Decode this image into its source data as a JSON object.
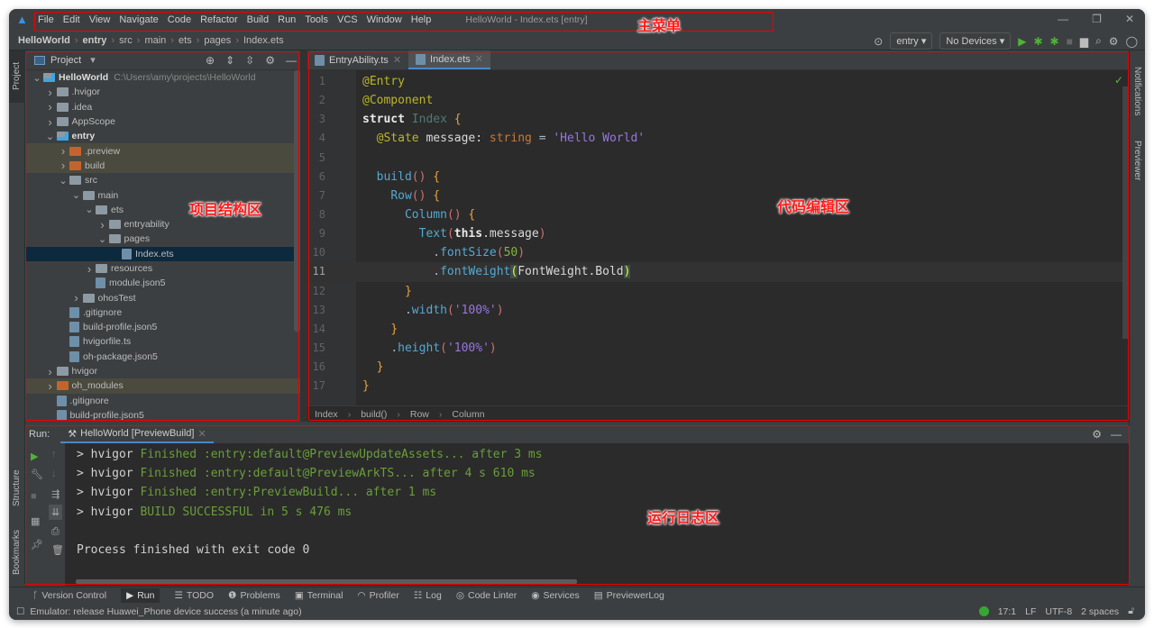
{
  "title": {
    "menu": [
      "File",
      "Edit",
      "View",
      "Navigate",
      "Code",
      "Refactor",
      "Build",
      "Run",
      "Tools",
      "VCS",
      "Window",
      "Help"
    ],
    "window_title": "HelloWorld - Index.ets [entry]"
  },
  "nav": {
    "breadcrumb": [
      "HelloWorld",
      "entry",
      "src",
      "main",
      "ets",
      "pages",
      "Index.ets"
    ],
    "run_config": "entry",
    "device": "No Devices"
  },
  "left_strip": {
    "project": "Project",
    "structure": "Structure",
    "bookmarks": "Bookmarks"
  },
  "right_strip": {
    "notifications": "Notifications",
    "previewer": "Previewer"
  },
  "project": {
    "title": "Project",
    "tree": [
      {
        "label": "HelloWorld",
        "level": 0,
        "kind": "module",
        "open": true,
        "bold": true,
        "hint": "C:\\Users\\amy\\projects\\HelloWorld"
      },
      {
        "label": ".hvigor",
        "level": 1,
        "kind": "folder",
        "open": false
      },
      {
        "label": ".idea",
        "level": 1,
        "kind": "folder",
        "open": false
      },
      {
        "label": "AppScope",
        "level": 1,
        "kind": "folder",
        "open": false
      },
      {
        "label": "entry",
        "level": 1,
        "kind": "module",
        "open": true,
        "bold": true
      },
      {
        "label": ".preview",
        "level": 2,
        "kind": "excluded",
        "open": false,
        "hl": true
      },
      {
        "label": "build",
        "level": 2,
        "kind": "excluded",
        "open": false,
        "hl": true
      },
      {
        "label": "src",
        "level": 2,
        "kind": "folder",
        "open": true
      },
      {
        "label": "main",
        "level": 3,
        "kind": "folder",
        "open": true
      },
      {
        "label": "ets",
        "level": 4,
        "kind": "folder",
        "open": true
      },
      {
        "label": "entryability",
        "level": 5,
        "kind": "folder",
        "open": false
      },
      {
        "label": "pages",
        "level": 5,
        "kind": "folder",
        "open": true
      },
      {
        "label": "Index.ets",
        "level": 6,
        "kind": "file",
        "sel": true
      },
      {
        "label": "resources",
        "level": 4,
        "kind": "folder",
        "open": false
      },
      {
        "label": "module.json5",
        "level": 4,
        "kind": "file"
      },
      {
        "label": "ohosTest",
        "level": 3,
        "kind": "folder",
        "open": false
      },
      {
        "label": ".gitignore",
        "level": 2,
        "kind": "file"
      },
      {
        "label": "build-profile.json5",
        "level": 2,
        "kind": "file"
      },
      {
        "label": "hvigorfile.ts",
        "level": 2,
        "kind": "file"
      },
      {
        "label": "oh-package.json5",
        "level": 2,
        "kind": "file"
      },
      {
        "label": "hvigor",
        "level": 1,
        "kind": "folder",
        "open": false
      },
      {
        "label": "oh_modules",
        "level": 1,
        "kind": "excluded",
        "open": false,
        "hl": true
      },
      {
        "label": ".gitignore",
        "level": 1,
        "kind": "file"
      },
      {
        "label": "build-profile.json5",
        "level": 1,
        "kind": "file"
      }
    ]
  },
  "editor": {
    "tabs": [
      {
        "label": "EntryAbility.ts",
        "active": false
      },
      {
        "label": "Index.ets",
        "active": true
      }
    ],
    "current_line": 11,
    "lines": [
      [
        [
          "@Entry",
          "an"
        ]
      ],
      [
        [
          "@Component",
          "an"
        ]
      ],
      [
        [
          "struct ",
          "kw"
        ],
        [
          "Index ",
          "cls"
        ],
        [
          "{",
          "br"
        ]
      ],
      [
        [
          "  ",
          " "
        ],
        [
          "@State ",
          "an"
        ],
        [
          "message: ",
          "id"
        ],
        [
          "string ",
          "ty"
        ],
        [
          "= ",
          "op"
        ],
        [
          "'Hello World'",
          "str"
        ]
      ],
      [],
      [
        [
          "  ",
          " "
        ],
        [
          "build",
          "fn"
        ],
        [
          "()",
          "pa"
        ],
        [
          " {",
          "br"
        ]
      ],
      [
        [
          "    ",
          " "
        ],
        [
          "Row",
          "fn"
        ],
        [
          "()",
          "pa"
        ],
        [
          " {",
          "br"
        ]
      ],
      [
        [
          "      ",
          " "
        ],
        [
          "Column",
          "fn"
        ],
        [
          "()",
          "pa"
        ],
        [
          " {",
          "br"
        ]
      ],
      [
        [
          "        ",
          " "
        ],
        [
          "Text",
          "fn"
        ],
        [
          "(",
          "pa"
        ],
        [
          "this",
          "kw"
        ],
        [
          ".message",
          "id"
        ],
        [
          ")",
          "pa"
        ]
      ],
      [
        [
          "          ",
          " "
        ],
        [
          ".",
          "op"
        ],
        [
          "fontSize",
          "fn"
        ],
        [
          "(",
          "pa"
        ],
        [
          "50",
          "num"
        ],
        [
          ")",
          "pa"
        ]
      ],
      [
        [
          "          ",
          " "
        ],
        [
          ".",
          "op"
        ],
        [
          "fontWeight",
          "fn"
        ],
        [
          "(",
          "mb"
        ],
        [
          "FontWeight.Bold",
          "id"
        ],
        [
          ")",
          "mb"
        ]
      ],
      [
        [
          "      ",
          " "
        ],
        [
          "}",
          "br"
        ]
      ],
      [
        [
          "      ",
          " "
        ],
        [
          ".",
          "op"
        ],
        [
          "width",
          "fn"
        ],
        [
          "(",
          "pa"
        ],
        [
          "'100%'",
          "str"
        ],
        [
          ")",
          "pa"
        ]
      ],
      [
        [
          "    ",
          " "
        ],
        [
          "}",
          "br"
        ]
      ],
      [
        [
          "    ",
          " "
        ],
        [
          ".",
          "op"
        ],
        [
          "height",
          "fn"
        ],
        [
          "(",
          "pa"
        ],
        [
          "'100%'",
          "str"
        ],
        [
          ")",
          "pa"
        ]
      ],
      [
        [
          "  ",
          " "
        ],
        [
          "}",
          "br"
        ]
      ],
      [
        [
          "}",
          "br"
        ]
      ]
    ],
    "breadcrumb": [
      "Index",
      "build()",
      "Row",
      "Column"
    ]
  },
  "run": {
    "label": "Run:",
    "tab": "HelloWorld [PreviewBuild]",
    "log": [
      {
        "p": "> hvigor ",
        "g": "Finished :entry:default@PreviewUpdateAssets... after 3 ms"
      },
      {
        "p": "> hvigor ",
        "g": "Finished :entry:default@PreviewArkTS... after 4 s 610 ms"
      },
      {
        "p": "> hvigor ",
        "g": "Finished :entry:PreviewBuild... after 1 ms"
      },
      {
        "p": "> hvigor ",
        "g": "BUILD SUCCESSFUL in 5 s 476 ms"
      },
      {
        "p": "",
        "g": ""
      },
      {
        "p": "Process finished with exit code 0",
        "g": ""
      }
    ]
  },
  "bottom_tabs": [
    {
      "icon": "branch",
      "label": "Version Control"
    },
    {
      "icon": "play",
      "label": "Run",
      "active": true
    },
    {
      "icon": "list",
      "label": "TODO"
    },
    {
      "icon": "alert",
      "label": "Problems"
    },
    {
      "icon": "terminal",
      "label": "Terminal"
    },
    {
      "icon": "gauge",
      "label": "Profiler"
    },
    {
      "icon": "log",
      "label": "Log"
    },
    {
      "icon": "linter",
      "label": "Code Linter"
    },
    {
      "icon": "services",
      "label": "Services"
    },
    {
      "icon": "doc",
      "label": "PreviewerLog"
    }
  ],
  "status": {
    "message": "Emulator: release Huawei_Phone device success (a minute ago)",
    "position": "17:1",
    "line_sep": "LF",
    "encoding": "UTF-8",
    "indent": "2 spaces",
    "status_color": "#36a832"
  },
  "annotations": {
    "menu": "主菜单",
    "project": "项目结构区",
    "editor": "代码编辑区",
    "run": "运行日志区"
  }
}
